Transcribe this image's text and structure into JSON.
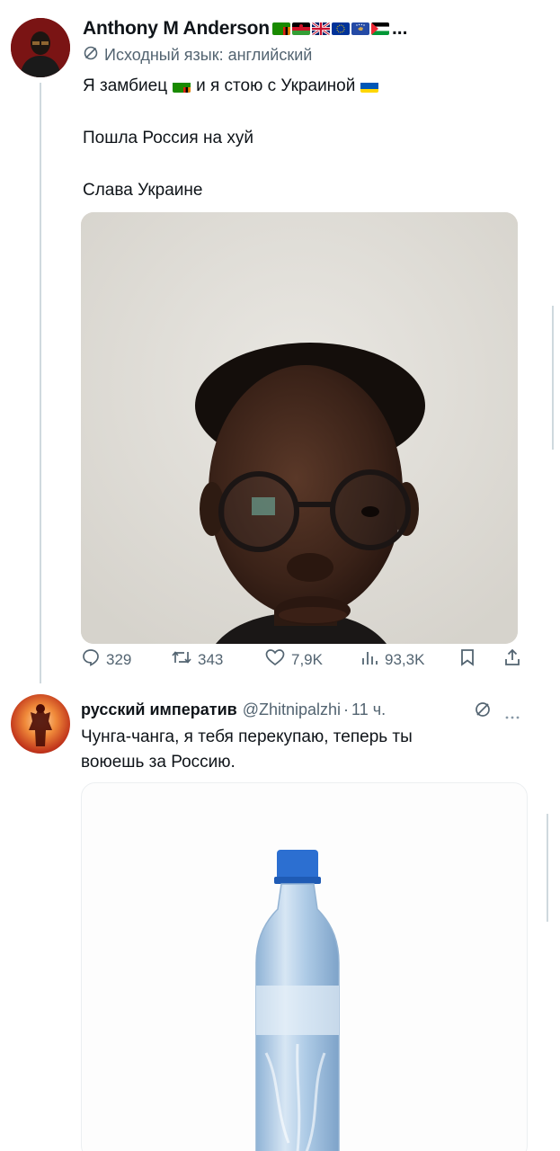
{
  "tweet": {
    "author_name": "Anthony M Anderson",
    "name_ellipsis": "...",
    "translated_label": "Исходный язык: английский",
    "text_line1_a": "Я замбиец",
    "text_line1_b": "и я стою с Украиной",
    "text_line2": "Пошла Россия на хуй",
    "text_line3": "Слава Украине",
    "flag_icons": [
      "zambia-flag-icon",
      "malawi-flag-icon",
      "uk-flag-icon",
      "eu-flag-icon",
      "kosovo-flag-icon",
      "palestine-flag-icon"
    ],
    "stats": {
      "replies": "329",
      "retweets": "343",
      "likes": "7,9K",
      "views": "93,3K"
    }
  },
  "reply": {
    "author_name": "русский императив",
    "handle": "@Zhitnipalzhi",
    "dot": "·",
    "time": "11 ч.",
    "text": "Чунга-чанга, я тебя перекупаю, теперь ты воюешь за Россию."
  },
  "colors": {
    "text": "#0f1419",
    "secondary": "#536471",
    "thread_line": "#cfd9de"
  }
}
